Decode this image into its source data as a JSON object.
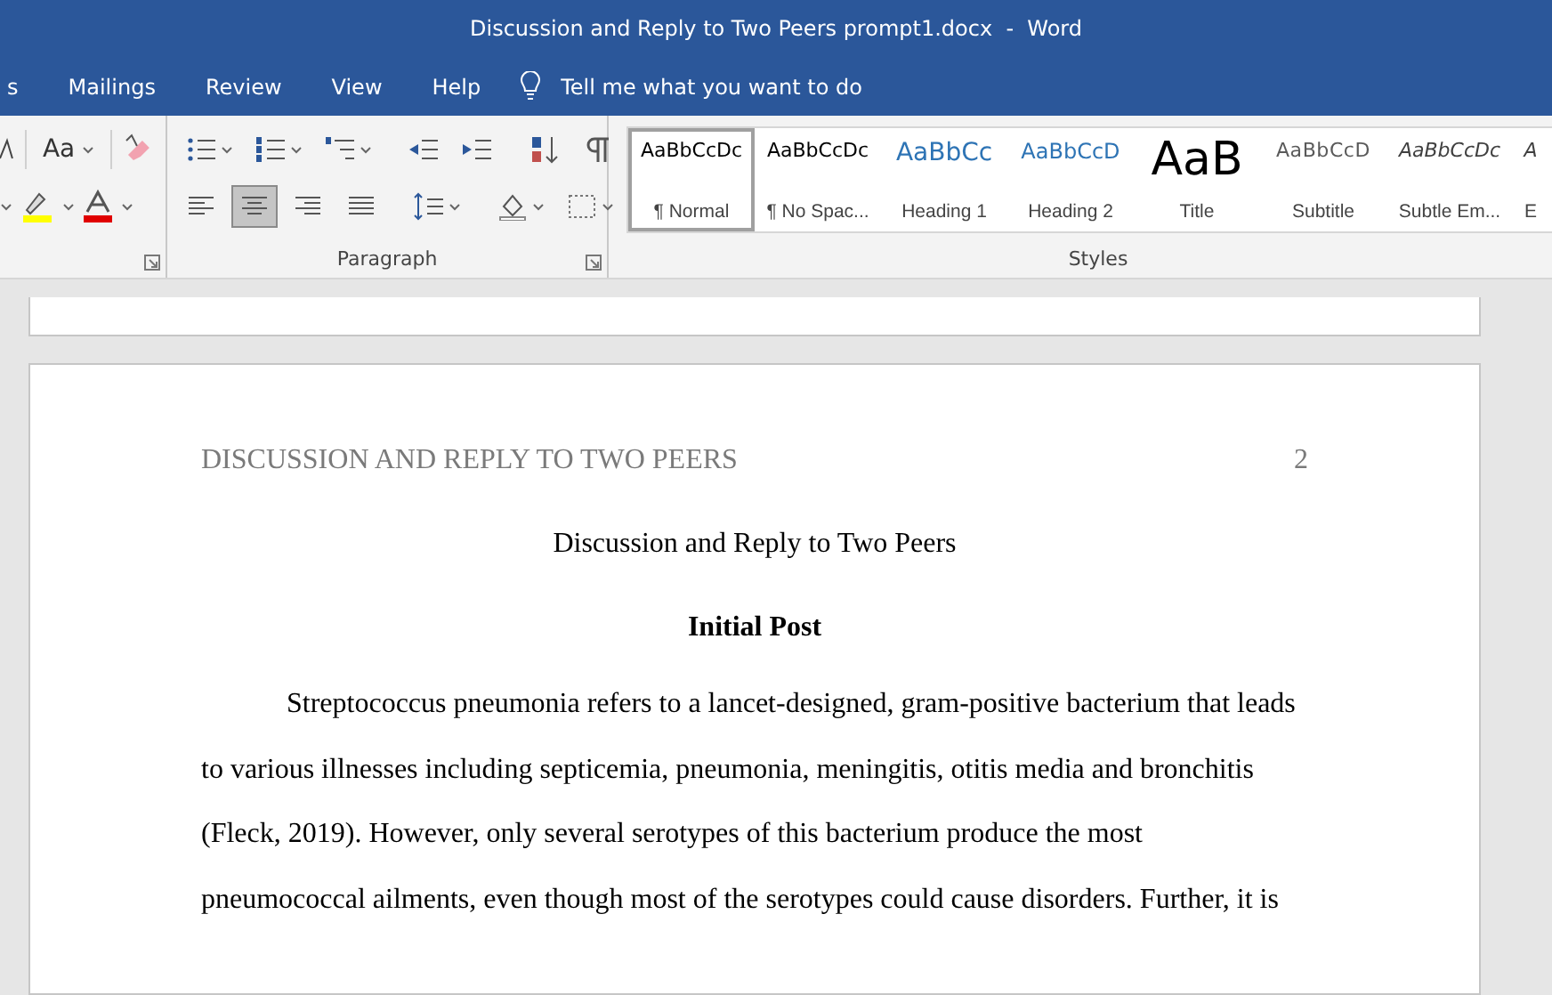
{
  "window": {
    "title": "Discussion and Reply to Two Peers prompt1.docx  -  Word"
  },
  "tabs": [
    {
      "label": "s",
      "selected": false
    },
    {
      "label": "Mailings",
      "selected": false
    },
    {
      "label": "Review",
      "selected": false
    },
    {
      "label": "View",
      "selected": false
    },
    {
      "label": "Help",
      "selected": false
    }
  ],
  "tell_me": {
    "placeholder": "Tell me what you want to do"
  },
  "font_group": {
    "change_case": "Aa"
  },
  "paragraph_group": {
    "label": "Paragraph",
    "row_1": [
      {
        "kind": "bullets",
        "selected": false
      },
      {
        "kind": "numbering",
        "selected": false
      },
      {
        "kind": "multilevel",
        "selected": false
      },
      {
        "kind": "decrease-indent",
        "selected": false
      },
      {
        "kind": "increase-indent",
        "selected": false
      },
      {
        "kind": "sort",
        "selected": false
      },
      {
        "kind": "pilcrow",
        "selected": false
      }
    ],
    "row_2": [
      {
        "kind": "align-left",
        "selected": false
      },
      {
        "kind": "align-center",
        "selected": true
      },
      {
        "kind": "align-right",
        "selected": false
      },
      {
        "kind": "justify",
        "selected": false
      },
      {
        "kind": "line-spacing",
        "selected": false
      },
      {
        "kind": "shading",
        "selected": false
      },
      {
        "kind": "borders",
        "selected": false
      }
    ]
  },
  "styles_group": {
    "label": "Styles",
    "styles": [
      {
        "preview": "AaBbCcDc",
        "name": "¶ Normal",
        "kind": "normal",
        "selected": true
      },
      {
        "preview": "AaBbCcDc",
        "name": "¶ No Spac...",
        "kind": "normal",
        "selected": false
      },
      {
        "preview": "AaBbCc",
        "name": "Heading 1",
        "kind": "heading1",
        "selected": false
      },
      {
        "preview": "AaBbCcD",
        "name": "Heading 2",
        "kind": "heading2",
        "selected": false
      },
      {
        "preview": "AaB",
        "name": "Title",
        "kind": "title",
        "selected": false
      },
      {
        "preview": "AaBbCcD",
        "name": "Subtitle",
        "kind": "subtitle",
        "selected": false
      },
      {
        "preview": "AaBbCcDc",
        "name": "Subtle Em...",
        "kind": "emphasis",
        "selected": false
      },
      {
        "preview": "A",
        "name": "E",
        "kind": "emphasis",
        "selected": false
      }
    ]
  },
  "document": {
    "header": {
      "title": "DISCUSSION AND REPLY TO TWO PEERS",
      "page_number": "2"
    },
    "title": "Discussion and Reply to Two Peers",
    "heading": "Initial Post",
    "paragraph": "Streptococcus pneumonia refers to a lancet-designed, gram-positive bacterium that leads to various illnesses including septicemia, pneumonia, meningitis, otitis media and bronchitis (Fleck, 2019). However, only several serotypes of this bacterium produce the most pneumococcal ailments, even though most of the serotypes could cause disorders. Further, it is"
  }
}
